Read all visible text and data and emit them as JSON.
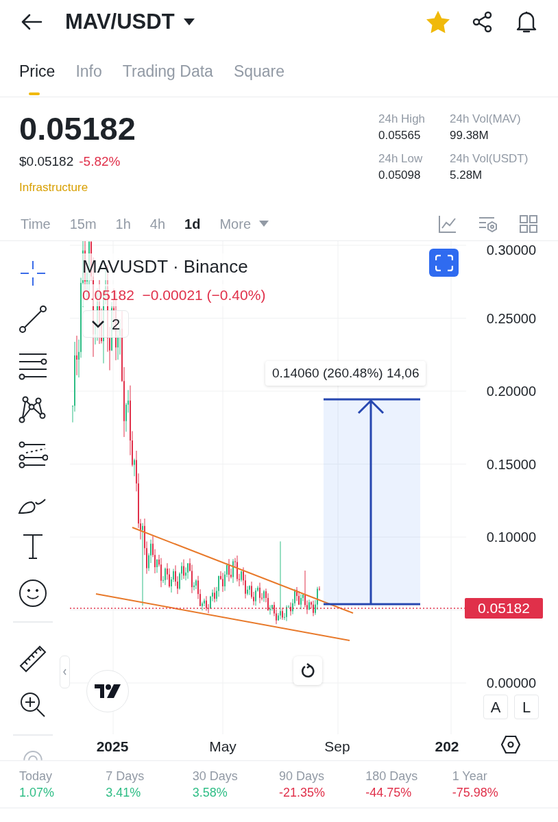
{
  "header": {
    "title": "MAV/USDT",
    "favorite": true
  },
  "tabs": [
    {
      "label": "Price",
      "selected": true
    },
    {
      "label": "Info",
      "selected": false
    },
    {
      "label": "Trading Data",
      "selected": false
    },
    {
      "label": "Square",
      "selected": false
    }
  ],
  "price": {
    "last": "0.05182",
    "usd": "$0.05182",
    "change": "-5.82%",
    "category": "Infrastructure"
  },
  "stats": [
    {
      "label": "24h High",
      "value": "0.05565"
    },
    {
      "label": "24h Vol(MAV)",
      "value": "99.38M"
    },
    {
      "label": "24h Low",
      "value": "0.05098"
    },
    {
      "label": "24h Vol(USDT)",
      "value": "5.28M"
    }
  ],
  "intervals": [
    {
      "label": "Time",
      "selected": false
    },
    {
      "label": "15m",
      "selected": false
    },
    {
      "label": "1h",
      "selected": false
    },
    {
      "label": "4h",
      "selected": false
    },
    {
      "label": "1d",
      "selected": true
    },
    {
      "label": "More",
      "selected": false
    }
  ],
  "drawing_tools": [
    {
      "kind": "crosshair",
      "selected": true
    },
    {
      "kind": "trendline",
      "selected": false
    },
    {
      "kind": "lines",
      "selected": false
    },
    {
      "kind": "pattern",
      "selected": false
    },
    {
      "kind": "fib",
      "selected": false
    },
    {
      "kind": "brush",
      "selected": false
    },
    {
      "kind": "text",
      "selected": false
    },
    {
      "kind": "emoji",
      "selected": false
    },
    {
      "kind": "ruler",
      "selected": false
    },
    {
      "kind": "zoom",
      "selected": false
    }
  ],
  "chart": {
    "symbol": "MAVUSDT · Binance",
    "quote": "0.05182  −0.00021 (−0.40%)",
    "indicators_count": "2",
    "measure_label": "0.14060 (260.48%) 14,06",
    "price_tag": "0.05182",
    "price_axis": [
      "0.30000",
      "0.25000",
      "0.20000",
      "0.15000",
      "0.10000",
      "0.00000"
    ],
    "time_axis": [
      {
        "label": "2025",
        "kind": "year"
      },
      {
        "label": "May",
        "kind": "month"
      },
      {
        "label": "Sep",
        "kind": "month"
      },
      {
        "label": "202",
        "kind": "year"
      }
    ],
    "scale_buttons": [
      "A",
      "L"
    ]
  },
  "performance": [
    {
      "label": "Today",
      "value": "1.07%",
      "color": "#2ebd85"
    },
    {
      "label": "7 Days",
      "value": "3.41%",
      "color": "#2ebd85"
    },
    {
      "label": "30 Days",
      "value": "3.58%",
      "color": "#2ebd85"
    },
    {
      "label": "90 Days",
      "value": "-21.35%",
      "color": "#e0304a"
    },
    {
      "label": "180 Days",
      "value": "-44.75%",
      "color": "#e0304a"
    },
    {
      "label": "1 Year",
      "value": "-75.98%",
      "color": "#e0304a"
    }
  ]
}
